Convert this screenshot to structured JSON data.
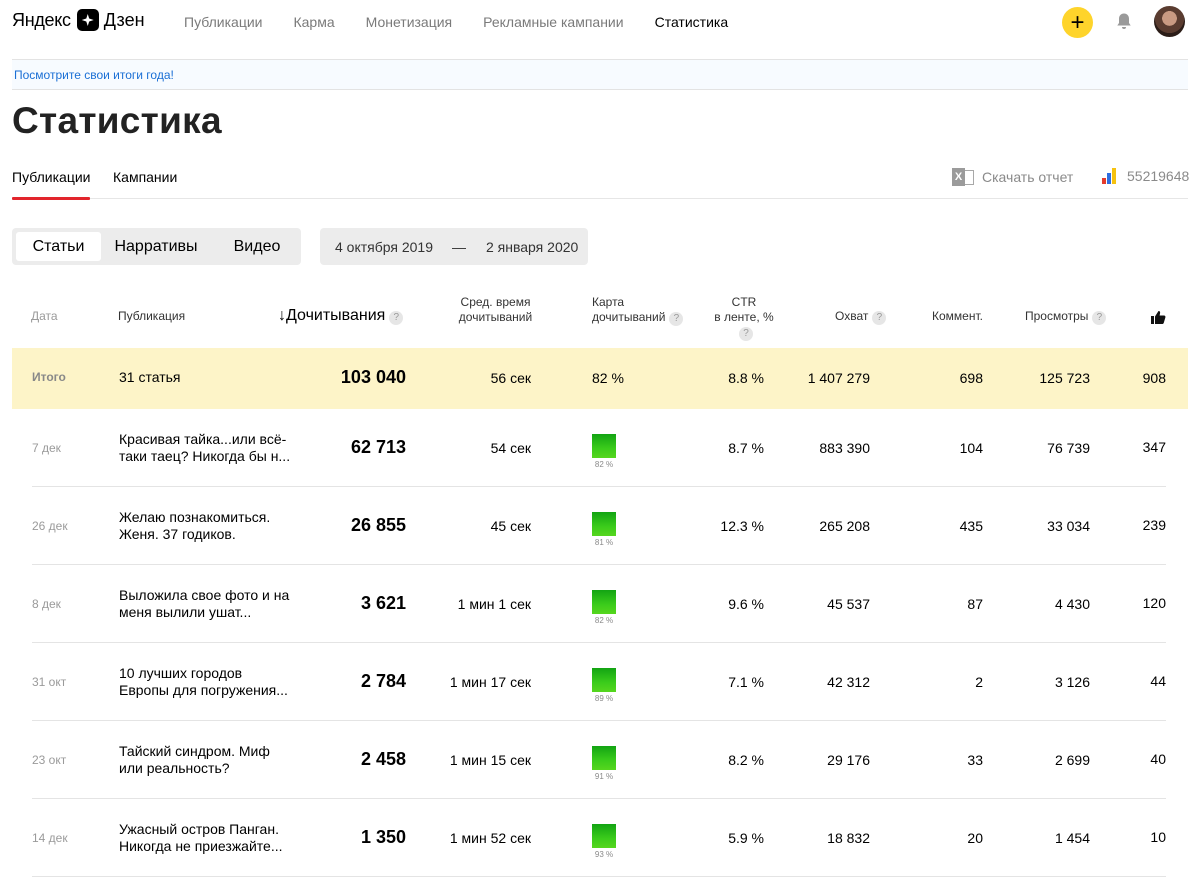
{
  "header": {
    "logo_left": "Яндекс",
    "logo_right": "Дзен",
    "nav": [
      "Публикации",
      "Карма",
      "Монетизация",
      "Рекламные кампании",
      "Статистика"
    ],
    "nav_active": "Статистика",
    "plus_label": "+"
  },
  "banner": {
    "text": "Посмотрите свои итоги года!"
  },
  "page": {
    "title": "Статистика"
  },
  "tabs": {
    "publications": "Публикации",
    "campaigns": "Кампании"
  },
  "actions": {
    "download": "Скачать отчет",
    "metrica_id": "55219648"
  },
  "content_types": [
    "Статьи",
    "Нарративы",
    "Видео"
  ],
  "content_type_selected": "Статьи",
  "date_range": {
    "from": "4 октября 2019",
    "dash": "—",
    "to": "2 января 2020"
  },
  "table": {
    "headers": {
      "date": "Дата",
      "publication": "Публикация",
      "reads": "Дочитывания",
      "avg_time_1": "Сред. время",
      "avg_time_2": "дочитываний",
      "map_1": "Карта",
      "map_2": "дочитываний",
      "ctr_1": "CTR",
      "ctr_2": "в ленте, %",
      "reach": "Охват",
      "comments": "Коммент.",
      "views": "Просмотры",
      "help": "?"
    },
    "total": {
      "label": "Итого",
      "publication": "31 статья",
      "reads": "103 040",
      "time": "56 сек",
      "map": "82 %",
      "ctr": "8.8 %",
      "reach": "1 407 279",
      "comments": "698",
      "views": "125 723",
      "likes": "908"
    },
    "rows": [
      {
        "date": "7 дек",
        "title": "Красивая тайка...или всё-таки таец? Никогда бы н...",
        "reads": "62 713",
        "time": "54 сек",
        "map": "82 %",
        "ctr": "8.7 %",
        "reach": "883 390",
        "comments": "104",
        "views": "76 739",
        "likes": "347"
      },
      {
        "date": "26 дек",
        "title": "Желаю познакомиться. Женя. 37 годиков.",
        "reads": "26 855",
        "time": "45 сек",
        "map": "81 %",
        "ctr": "12.3 %",
        "reach": "265 208",
        "comments": "435",
        "views": "33 034",
        "likes": "239"
      },
      {
        "date": "8 дек",
        "title": "Выложила свое фото и на меня вылили ушат...",
        "reads": "3 621",
        "time": "1 мин 1 сек",
        "map": "82 %",
        "ctr": "9.6 %",
        "reach": "45 537",
        "comments": "87",
        "views": "4 430",
        "likes": "120"
      },
      {
        "date": "31 окт",
        "title": "10 лучших городов Европы для погружения...",
        "reads": "2 784",
        "time": "1 мин 17 сек",
        "map": "89 %",
        "ctr": "7.1 %",
        "reach": "42 312",
        "comments": "2",
        "views": "3 126",
        "likes": "44"
      },
      {
        "date": "23 окт",
        "title": "Тайский синдром. Миф или реальность?",
        "reads": "2 458",
        "time": "1 мин 15 сек",
        "map": "91 %",
        "ctr": "8.2 %",
        "reach": "29 176",
        "comments": "33",
        "views": "2 699",
        "likes": "40"
      },
      {
        "date": "14 дек",
        "title": "Ужасный остров Панган. Никогда не приезжайте...",
        "reads": "1 350",
        "time": "1 мин 52 сек",
        "map": "93 %",
        "ctr": "5.9 %",
        "reach": "18 832",
        "comments": "20",
        "views": "1 454",
        "likes": "10"
      }
    ]
  },
  "colors": {
    "accent_yellow": "#fed42b",
    "tab_underline": "#e2252c",
    "link_blue": "#1a6fd5",
    "total_row_bg": "#fdf4c8",
    "bar_green": "#2fb81a"
  }
}
